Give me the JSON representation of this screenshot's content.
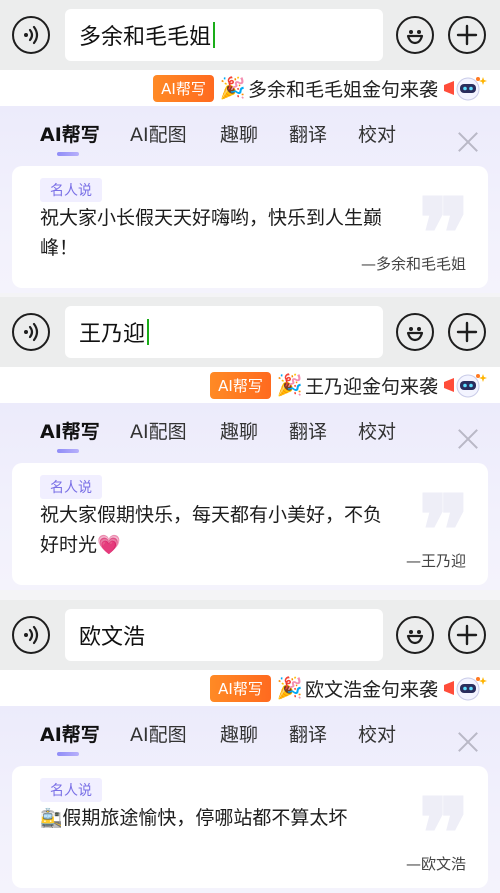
{
  "sections": [
    {
      "input_text": "多余和毛毛姐",
      "promo": {
        "badge": "AI帮写",
        "text": "多余和毛毛姐金句来袭"
      },
      "tabs": [
        "AI帮写",
        "AI配图",
        "趣聊",
        "翻译",
        "校对"
      ],
      "quote": {
        "tag": "名人说",
        "text": "祝大家小长假天天好嗨哟，快乐到人生巅峰！",
        "author": "—多余和毛毛姐"
      }
    },
    {
      "input_text": "王乃迎",
      "promo": {
        "badge": "AI帮写",
        "text": "王乃迎金句来袭"
      },
      "tabs": [
        "AI帮写",
        "AI配图",
        "趣聊",
        "翻译",
        "校对"
      ],
      "quote": {
        "tag": "名人说",
        "text": "祝大家假期快乐，每天都有小美好，不负好时光",
        "emoji": "💗",
        "author": "—王乃迎"
      }
    },
    {
      "input_text": "欧文浩",
      "promo": {
        "badge": "AI帮写",
        "text": "欧文浩金句来袭"
      },
      "tabs": [
        "AI帮写",
        "AI配图",
        "趣聊",
        "翻译",
        "校对"
      ],
      "quote": {
        "tag": "名人说",
        "lead_emoji": "🚉",
        "text": "假期旅途愉快，停哪站都不算太坏",
        "author": "—欧文浩"
      }
    }
  ],
  "icons": {
    "voice": "voice-input-icon",
    "emoji": "emoji-smile-icon",
    "plus": "plus-icon",
    "party": "party-popper-icon",
    "robot": "ai-robot-mascot-icon",
    "close": "close-icon"
  },
  "colors": {
    "accent": "#8f8cf7",
    "badge": "#ff7a22",
    "caret": "#1aad19",
    "tag_text": "#7a70e6"
  }
}
